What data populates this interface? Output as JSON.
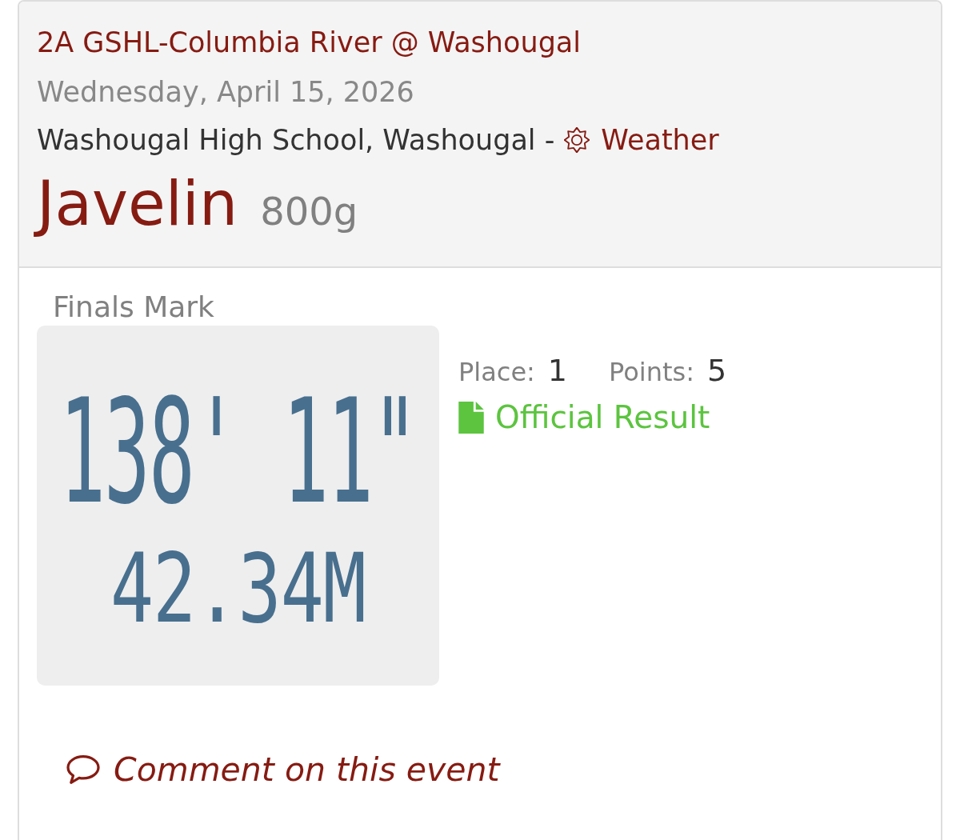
{
  "meet": {
    "title": "2A GSHL-Columbia River @ Washougal",
    "date": "Wednesday, April 15, 2026",
    "venue": "Washougal High School, Washougal -",
    "weather_link": "Weather"
  },
  "event": {
    "name": "Javelin",
    "spec": "800g"
  },
  "mark": {
    "label": "Finals Mark",
    "imperial": "138' 11\"",
    "metric": "42.34M"
  },
  "result": {
    "place_label": "Place:",
    "place": "1",
    "points_label": "Points:",
    "points": "5",
    "official_link": "Official Result"
  },
  "comment_link": "Comment on this event"
}
